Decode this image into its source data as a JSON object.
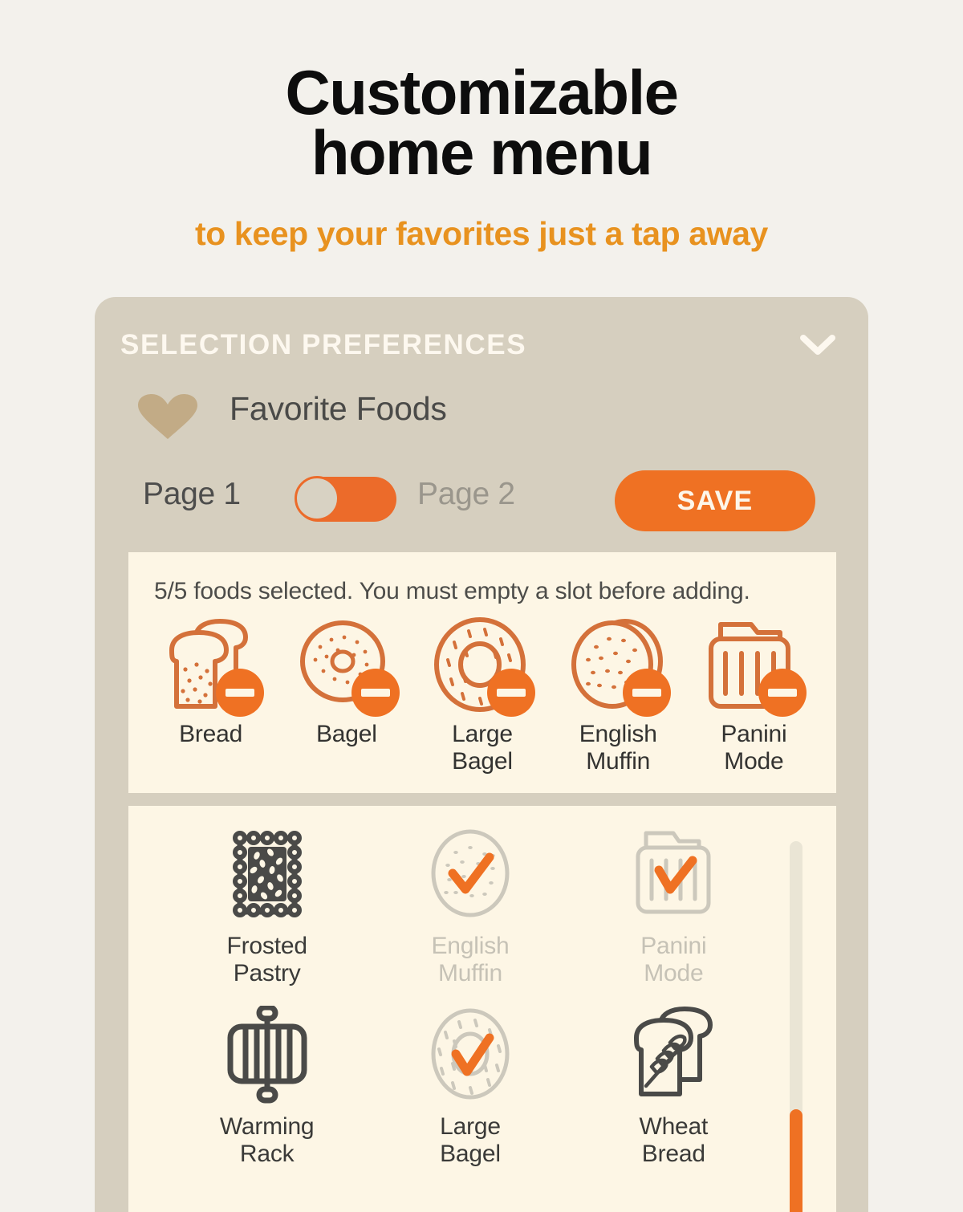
{
  "hero": {
    "title_line1": "Customizable",
    "title_line2": "home menu",
    "subtitle": "to keep your favorites just a tap away",
    "title_color": "#0d0d0d",
    "subtitle_color": "#e8921f"
  },
  "card": {
    "title": "SELECTION PREFERENCES",
    "collapse_icon": "chevron-down-icon",
    "background": "#d6cfbf",
    "section": {
      "icon": "heart-icon",
      "label": "Favorite Foods"
    },
    "pager": {
      "page1_label": "Page 1",
      "page2_label": "Page 2",
      "active_page": "Page 1",
      "toggle_state": "left"
    },
    "save_label": "SAVE",
    "accent_color": "#ef7123"
  },
  "selected_panel": {
    "status": "5/5 foods selected. You must empty a slot before adding.",
    "items": [
      {
        "label": "Bread",
        "icon": "bread-slices-icon",
        "badge": "minus-badge-icon"
      },
      {
        "label": "Bagel",
        "icon": "bagel-icon",
        "badge": "minus-badge-icon"
      },
      {
        "label": "Large\nBagel",
        "label_l1": "Large",
        "label_l2": "Bagel",
        "icon": "large-bagel-icon",
        "badge": "minus-badge-icon"
      },
      {
        "label": "English Muffin",
        "label_l1": "English",
        "label_l2": "Muffin",
        "icon": "english-muffin-icon",
        "badge": "minus-badge-icon"
      },
      {
        "label": "Panini Mode",
        "label_l1": "Panini",
        "label_l2": "Mode",
        "icon": "panini-press-icon",
        "badge": "minus-badge-icon"
      }
    ]
  },
  "available_panel": {
    "items": [
      {
        "label_l1": "Frosted",
        "label_l2": "Pastry",
        "icon": "frosted-pastry-icon",
        "state": "available",
        "checked": false
      },
      {
        "label_l1": "English",
        "label_l2": "Muffin",
        "icon": "english-muffin-icon",
        "state": "selected",
        "checked": true
      },
      {
        "label_l1": "Panini",
        "label_l2": "Mode",
        "icon": "panini-press-icon",
        "state": "selected",
        "checked": true
      },
      {
        "label_l1": "Warming",
        "label_l2": "Rack",
        "icon": "warming-rack-icon",
        "state": "available",
        "checked": false
      },
      {
        "label_l1": "Large",
        "label_l2": "Bagel",
        "icon": "large-bagel-icon",
        "state": "selected",
        "checked": true
      },
      {
        "label_l1": "Wheat",
        "label_l2": "Bread",
        "icon": "wheat-bread-icon",
        "state": "available",
        "checked": false
      }
    ],
    "scrollbar": {
      "name": "vertical-scrollbar",
      "thumb_color": "#ef7123",
      "track_color": "#eae5d5"
    }
  }
}
